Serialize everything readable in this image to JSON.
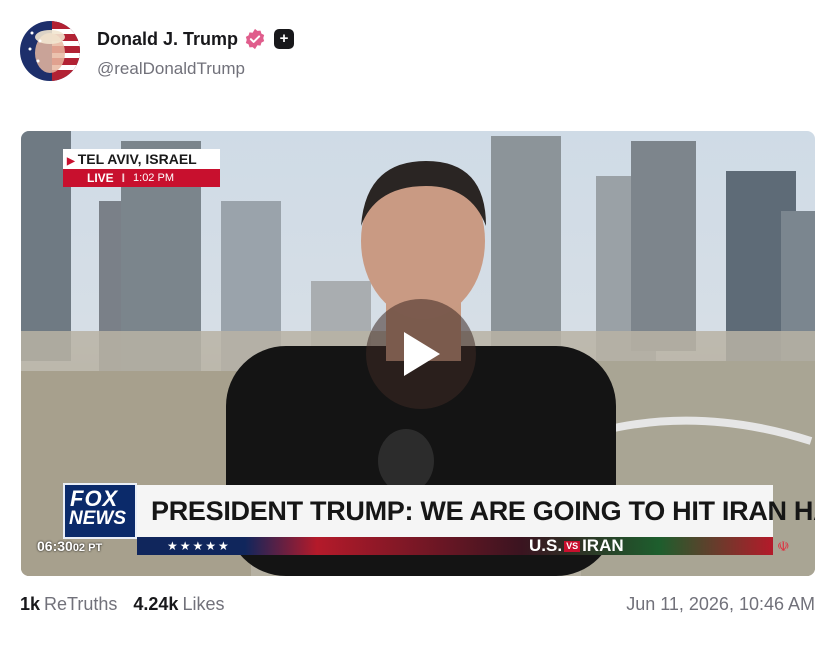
{
  "post": {
    "author_name": "Donald J. Trump",
    "handle": "@realDonaldTrump",
    "badges": [
      "verified-badge-icon",
      "plus-square-icon"
    ]
  },
  "video": {
    "location": "TEL AVIV, ISRAEL",
    "live_label": "LIVE",
    "live_sep": "I",
    "live_time": "1:02 PM",
    "network_top": "FOX",
    "network_bottom": "NEWS",
    "headline": "PRESIDENT TRUMP: WE ARE GOING TO HIT IRAN HARD",
    "ticker_us": "U.S.",
    "ticker_vs": "VS",
    "ticker_iran": "IRAN",
    "clock": "06:30",
    "clock_suffix": "02 PT",
    "play_icon": "play-icon"
  },
  "stats": {
    "retruths_count": "1k",
    "retruths_label": "ReTruths",
    "likes_count": "4.24k",
    "likes_label": "Likes",
    "timestamp": "Jun 11, 2026, 10:46 AM"
  },
  "colors": {
    "fox_red": "#c8102e",
    "fox_blue": "#0b2a6a",
    "verified_pink": "#e05d8c",
    "muted_text": "#71717a"
  }
}
